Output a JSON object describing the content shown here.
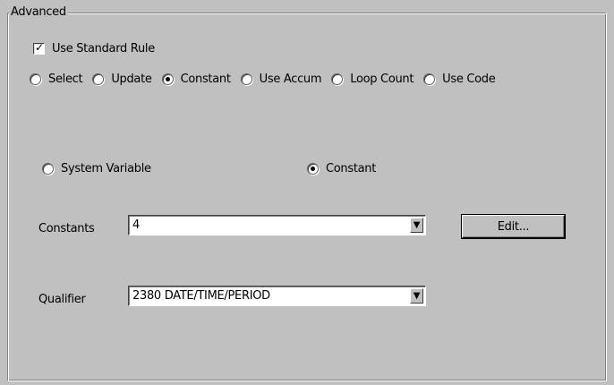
{
  "group": {
    "title": "Advanced"
  },
  "use_standard_rule": {
    "label": "Use Standard Rule",
    "checked": true
  },
  "mode_options": [
    {
      "label": "Select",
      "selected": false
    },
    {
      "label": "Update",
      "selected": false
    },
    {
      "label": "Constant",
      "selected": true
    },
    {
      "label": "Use Accum",
      "selected": false
    },
    {
      "label": "Loop Count",
      "selected": false
    },
    {
      "label": "Use Code",
      "selected": false
    }
  ],
  "source_options": {
    "system_variable": {
      "label": "System Variable",
      "selected": false
    },
    "constant": {
      "label": "Constant",
      "selected": true
    }
  },
  "constants": {
    "label": "Constants",
    "value": "4",
    "edit_label": "Edit..."
  },
  "qualifier": {
    "label": "Qualifier",
    "value": "2380 DATE/TIME/PERIOD"
  },
  "icons": {
    "dropdown": "dropdown-arrow-icon",
    "checkmark": "checkmark-icon"
  }
}
